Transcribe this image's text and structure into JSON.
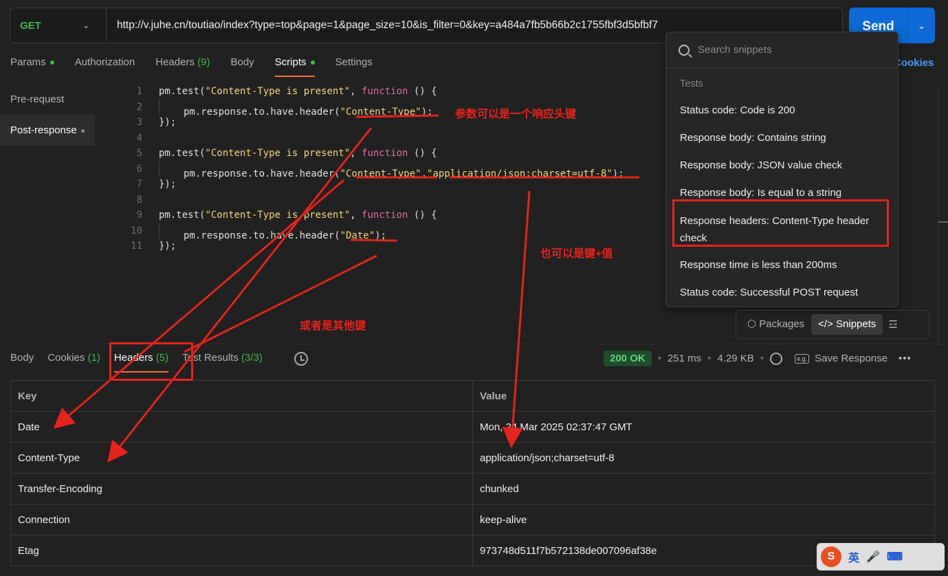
{
  "request": {
    "method": "GET",
    "url": "http://v.juhe.cn/toutiao/index?type=top&page=1&page_size=10&is_filter=0&key=a484a7fb5b66b2c1755fbf3d5bfbf7",
    "send_label": "Send"
  },
  "req_tabs": {
    "params": "Params",
    "authorization": "Authorization",
    "headers": "Headers",
    "headers_count": "(9)",
    "body": "Body",
    "scripts": "Scripts",
    "settings": "Settings",
    "cookies": "Cookies"
  },
  "side": {
    "pre": "Pre-request",
    "post": "Post-response"
  },
  "code": {
    "n1": "1",
    "n2": "2",
    "n3": "3",
    "n4": "4",
    "n5": "5",
    "n6": "6",
    "n7": "7",
    "n8": "8",
    "n9": "9",
    "n10": "10",
    "n11": "11",
    "pmtest": "pm.test(",
    "test_name": "\"Content-Type is present\"",
    "comma": ", ",
    "function_kw": "function",
    "fn_tail": " () {",
    "resp_header": "pm.response.to.have.header(",
    "ct_str": "\"Content-Type\"",
    "val_str": "\"application/json;charset=utf-8\"",
    "date_str": "\"Date\"",
    "close_call": ");",
    "close_block": "});",
    "comma_only": ","
  },
  "annotations": {
    "a1": "参数可以是一个响应头键",
    "a2": "也可以是键+值",
    "a3": "或者是其他键"
  },
  "snippets": {
    "placeholder": "Search snippets",
    "group": "Tests",
    "items": [
      "Status code: Code is 200",
      "Response body: Contains string",
      "Response body: JSON value check",
      "Response body: Is equal to a string",
      "Response headers: Content-Type header check",
      "Response time is less than 200ms",
      "Status code: Successful POST request"
    ],
    "packages": "Packages",
    "snippets_btn": "Snippets"
  },
  "resp_tabs": {
    "body": "Body",
    "cookies": "Cookies",
    "cookies_count": "(1)",
    "headers": "Headers",
    "headers_count": "(5)",
    "tests": "Test Results",
    "tests_count": "(3/3)"
  },
  "status": {
    "code": "200 OK",
    "time": "251 ms",
    "size": "4.29 KB",
    "save": "Save Response",
    "eg": "e.g."
  },
  "table": {
    "key_header": "Key",
    "value_header": "Value",
    "rows": [
      {
        "key": "Date",
        "value": "Mon, 24 Mar 2025 02:37:47 GMT"
      },
      {
        "key": "Content-Type",
        "value": "application/json;charset=utf-8"
      },
      {
        "key": "Transfer-Encoding",
        "value": "chunked"
      },
      {
        "key": "Connection",
        "value": "keep-alive"
      },
      {
        "key": "Etag",
        "value": "973748d511f7b572138de007096af38e"
      }
    ]
  },
  "ime": {
    "s": "S",
    "lang": "英"
  },
  "colors": {
    "accent": "#ff6c37",
    "send": "#0d6ad7",
    "get": "#3fb950",
    "annotation": "#e8231b"
  }
}
